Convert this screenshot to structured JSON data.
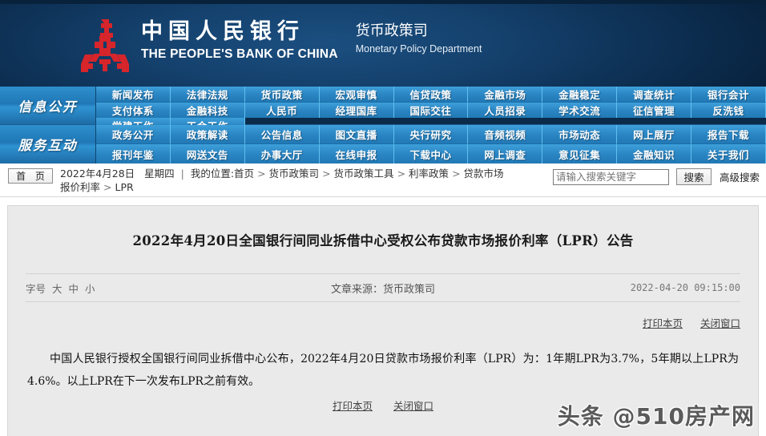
{
  "header": {
    "bank_name_cn": "中国人民银行",
    "bank_name_en": "THE PEOPLE'S BANK OF CHINA",
    "department_cn": "货币政策司",
    "department_en": "Monetary Policy Department",
    "logo_color": "#d6252b",
    "banner_color": "#113c66"
  },
  "nav": {
    "groups": [
      {
        "label": "信息公开",
        "items": [
          "新闻发布",
          "法律法规",
          "货币政策",
          "宏观审慎",
          "信贷政策",
          "金融市场",
          "金融稳定",
          "调查统计",
          "银行会计",
          "支付体系",
          "金融科技",
          "人民币",
          "经理国库",
          "国际交往",
          "人员招录",
          "学术交流",
          "征信管理",
          "反洗钱",
          "党建工作",
          "工会工作"
        ]
      },
      {
        "label": "服务互动",
        "items": [
          "政务公开",
          "政策解读",
          "公告信息",
          "图文直播",
          "央行研究",
          "音频视频",
          "市场动态",
          "网上展厅",
          "报告下载",
          "报刊年鉴",
          "网送文告",
          "办事大厅",
          "在线申报",
          "下载中心",
          "网上调查",
          "意见征集",
          "金融知识",
          "关于我们"
        ]
      }
    ]
  },
  "crumb": {
    "home_label": "首 页",
    "date": "2022年4月28日",
    "weekday": "星期四",
    "divider": "|",
    "position_label": "我的位置:",
    "path": [
      "首页",
      "货币政策司",
      "货币政策工具",
      "利率政策",
      "贷款市场报价利率",
      "LPR"
    ],
    "separator": ">"
  },
  "search": {
    "placeholder": "请输入搜索关键字",
    "value": "",
    "button_label": "搜索",
    "advanced_label": "高级搜索"
  },
  "article": {
    "title": "2022年4月20日全国银行间同业拆借中心受权公布贷款市场报价利率（LPR）公告",
    "font_size_label": "字号",
    "font_size_options": [
      "大",
      "中",
      "小"
    ],
    "source": "文章来源：货币政策司",
    "timestamp": "2022-04-20 09:15:00",
    "print_label": "打印本页",
    "close_label": "关闭窗口",
    "body": "中国人民银行授权全国银行间同业拆借中心公布，2022年4月20日贷款市场报价利率（LPR）为：1年期LPR为3.7%，5年期以上LPR为4.6%。以上LPR在下一次发布LPR之前有效。"
  },
  "watermark": {
    "text": "头条 @510房产网"
  }
}
